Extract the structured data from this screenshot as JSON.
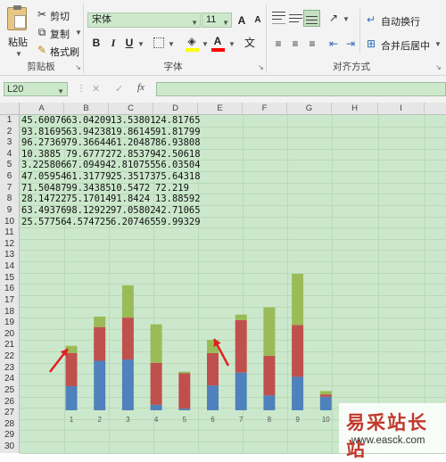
{
  "ribbon": {
    "clipboard": {
      "paste": "粘贴",
      "cut": "剪切",
      "copy": "复制",
      "format_painter": "格式刷",
      "group": "剪贴板"
    },
    "font": {
      "name": "宋体",
      "size": "11",
      "bold": "B",
      "italic": "I",
      "underline": "U",
      "font_color_glyph": "A",
      "group": "字体",
      "grow": "A",
      "shrink": "A",
      "wen": "文"
    },
    "align": {
      "wrap": "自动换行",
      "merge": "合并后居中",
      "group": "对齐方式"
    }
  },
  "formula_bar": {
    "name_box": "L20",
    "cancel": "✕",
    "enter": "✓",
    "fx": "fx",
    "value": ""
  },
  "columns": [
    "A",
    "B",
    "C",
    "D",
    "E",
    "F",
    "G",
    "H",
    "I"
  ],
  "rows": [
    "1",
    "2",
    "3",
    "4",
    "5",
    "6",
    "7",
    "8",
    "9",
    "10",
    "11",
    "12",
    "13",
    "14",
    "15",
    "16",
    "17",
    "18",
    "19",
    "20",
    "21",
    "22",
    "23",
    "24",
    "25",
    "26",
    "27",
    "28",
    "29",
    "30"
  ],
  "cells": [
    [
      "45.60076",
      "63.04209",
      "13.53801",
      "24.81765"
    ],
    [
      "93.81695",
      "63.94238",
      "19.86145",
      "91.81799"
    ],
    [
      "96.27369",
      "79.36644",
      "61.20487",
      "86.93808"
    ],
    [
      "10.3885",
      "79.67772",
      "72.85379",
      "42.50618"
    ],
    [
      "3.225806",
      "67.09494",
      "2.810755",
      "56.03504"
    ],
    [
      "47.05954",
      "61.31779",
      "25.35173",
      "75.64318"
    ],
    [
      "71.50487",
      "99.34385",
      "10.5472",
      "72.219"
    ],
    [
      "28.14722",
      "75.17014",
      "91.8424",
      "13.88592"
    ],
    [
      "63.49376",
      "98.12922",
      "97.05802",
      "42.71065"
    ],
    [
      "25.57756",
      "4.574725",
      "6.207465",
      "59.99329"
    ]
  ],
  "chart_data": {
    "type": "bar",
    "stacked": true,
    "categories": [
      "1",
      "2",
      "3",
      "4",
      "5",
      "6",
      "7",
      "8",
      "9",
      "10"
    ],
    "series": [
      {
        "values": [
          45.60076,
          93.81695,
          96.27369,
          10.3885,
          3.225806,
          47.05954,
          71.50487,
          28.14722,
          63.49376,
          25.57756
        ]
      },
      {
        "values": [
          63.04209,
          63.94238,
          79.36644,
          79.67772,
          67.09494,
          61.31779,
          99.34385,
          75.17014,
          98.12922,
          4.574725
        ]
      },
      {
        "values": [
          13.53801,
          19.86145,
          61.20487,
          72.85379,
          2.810755,
          25.35173,
          10.5472,
          91.8424,
          97.05802,
          6.207465
        ]
      }
    ],
    "colors": [
      "#4f81bd",
      "#c0504d",
      "#9bbb59"
    ],
    "arrow_color": "#e02020"
  },
  "watermark": {
    "title": "易采站长站",
    "url": "www.easck.com"
  }
}
